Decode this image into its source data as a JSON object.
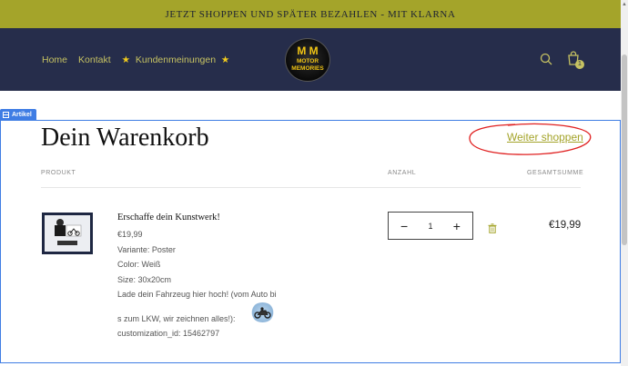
{
  "announcement": "JETZT SHOPPEN UND SPÄTER BEZAHLEN - MIT KLARNA",
  "nav": {
    "home": "Home",
    "contact": "Kontakt",
    "reviews_star_left": "★",
    "reviews": "Kundenmeinungen",
    "reviews_star_right": "★"
  },
  "logo": {
    "mark": "M M",
    "line1": "MOTOR",
    "line2": "MEMORIES"
  },
  "cart_count": "1",
  "section_tag": "Artikel",
  "cart": {
    "title": "Dein Warenkorb",
    "continue_link": "Weiter shoppen",
    "columns": {
      "product": "PRODUKT",
      "quantity": "ANZAHL",
      "total": "GESAMTSUMME"
    },
    "item": {
      "name": "Erschaffe dein Kunstwerk!",
      "price": "€19,99",
      "variant": "Variante: Poster",
      "color": "Color: Weiß",
      "size": "Size: 30x20cm",
      "upload_line1": "Lade dein Fahrzeug hier hoch! (vom Auto bi",
      "upload_line2": "s zum LKW, wir zeichnen alles!):",
      "customization": "customization_id: 15462797",
      "quantity": "1",
      "minus": "−",
      "plus": "+",
      "line_total": "€19,99"
    }
  },
  "colors": {
    "accent": "#a4a42a",
    "header": "#262d4b",
    "selection": "#3f7de4",
    "annotation": "#e02020"
  }
}
